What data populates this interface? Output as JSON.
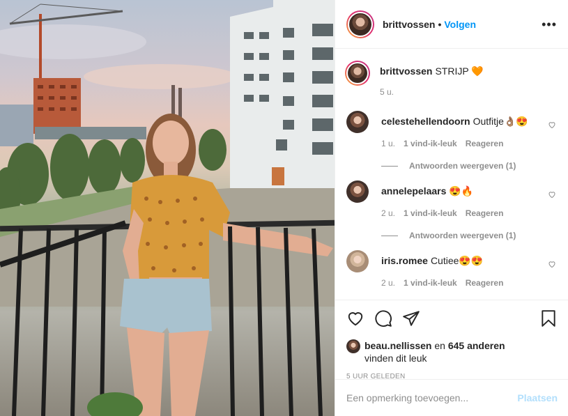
{
  "post": {
    "author": "brittvossen",
    "follow_label": "Volgen",
    "more_label": "•••",
    "caption": {
      "username": "brittvossen",
      "text": "STRIJP 🧡",
      "time": "5 u."
    }
  },
  "comments": [
    {
      "username": "celestehellendoorn",
      "text": "Outfitje👌🏽😍",
      "time": "1 u.",
      "likes": "1 vind-ik-leuk",
      "reply": "Reageren",
      "replies": "Antwoorden weergeven (1)"
    },
    {
      "username": "annelepelaars",
      "text": "😍🔥",
      "time": "2 u.",
      "likes": "1 vind-ik-leuk",
      "reply": "Reageren",
      "replies": "Antwoorden weergeven (1)"
    },
    {
      "username": "iris.romee",
      "text": "Cutiee😍😍",
      "time": "2 u.",
      "likes": "1 vind-ik-leuk",
      "reply": "Reageren"
    }
  ],
  "actions": {
    "like_icon": "heart-outline-icon",
    "comment_icon": "comment-bubble-icon",
    "share_icon": "paper-plane-icon",
    "save_icon": "bookmark-icon"
  },
  "likes": {
    "first": "beau.nellissen",
    "mid": " en ",
    "others": "645 anderen",
    "tail": "vinden dit leuk"
  },
  "timestamp": "5 uur geleden",
  "add_comment": {
    "placeholder": "Een opmerking toevoegen...",
    "post_label": "Plaatsen"
  },
  "colors": {
    "link": "#0095f6",
    "post_disabled": "#b2dffc",
    "meta": "#8e8e8e"
  }
}
